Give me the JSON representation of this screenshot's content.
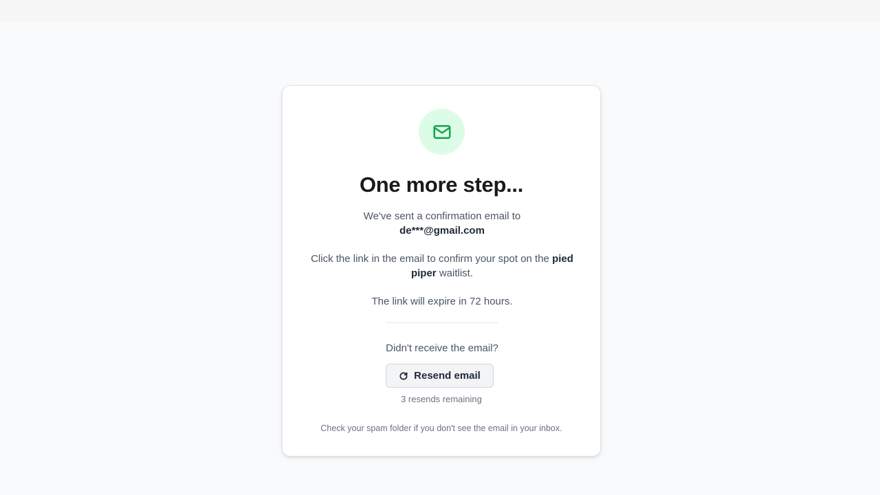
{
  "page": {
    "title": "One more step...",
    "sent_prefix": "We've sent a confirmation email to",
    "email": "de***@gmail.com",
    "confirm_prefix": "Click the link in the email to confirm your spot on the",
    "confirm_brand": "pied piper",
    "confirm_suffix": "waitlist.",
    "expiry": "The link will expire in 72 hours.",
    "not_received": "Didn't receive the email?",
    "resend_label": "Resend email",
    "resends_remaining": "3 resends remaining",
    "spam_note": "Check your spam folder if you don't see the email in your inbox."
  },
  "icons": {
    "header": "mail-icon",
    "resend": "refresh-icon"
  },
  "colors": {
    "accent": "#16a34a",
    "accent_bg": "#dcfce7"
  }
}
